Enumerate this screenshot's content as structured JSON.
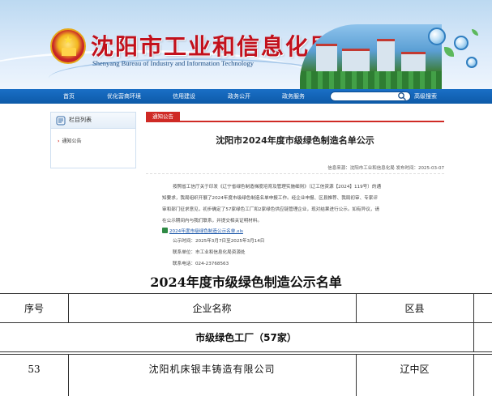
{
  "header": {
    "title": "沈阳市工业和信息化局",
    "subtitle": "Shenyang Bureau of Industry and Information Technology"
  },
  "nav": {
    "items": [
      "首页",
      "优化营商环境",
      "信用建设",
      "政务公开",
      "政务服务"
    ],
    "search_placeholder": "",
    "advanced_search": "高级搜索"
  },
  "sidebar": {
    "heading": "栏目列表",
    "items": [
      "通知公告"
    ]
  },
  "tab": {
    "active": "通知公告"
  },
  "article": {
    "title": "沈阳市2024年度市级绿色制造名单公示",
    "meta": "信息来源：沈阳市工业和信息化局 发布时间：2025-03-07",
    "paragraphs": [
      "按照省工信厅关于印发《辽宁省绿色制造梯度培育及管理实施细则》（辽工信资源【2024】119号）的通",
      "知要求，我局组织开展了2024年度市级绿色制造名单申报工作。经企业申报、区县推荐、我局初审、专家评",
      "审和部门征求意见，初步确定了57家绿色工厂和2家绿色供应链管理企业，现对结果进行公示。如有异议，请",
      "在公示期间内与我们联系，并提交相关证明材料。"
    ],
    "attachment": "2024年度市级绿色制造公示名单.xls",
    "info": [
      "公示时间：2025年3月7日至2025年3月14日",
      "联系单位：市工业和信息化局资源处",
      "联系电话：024-23768563"
    ]
  },
  "document_table": {
    "heading": "2024年度市级绿色制造公示名单",
    "columns": [
      "序号",
      "企业名称",
      "区县"
    ],
    "section": "市级绿色工厂（57家）",
    "rows": [
      {
        "no": "53",
        "company": "沈阳机床银丰铸造有限公司",
        "district": "辽中区"
      }
    ]
  },
  "colors": {
    "nav_blue": "#0d5aa8",
    "title_red": "#c2111c",
    "tab_red": "#cf2a25"
  },
  "icons": [
    "emblem",
    "search-icon",
    "sidebar-list-icon",
    "arrow-right-icon",
    "xls-file-icon"
  ]
}
